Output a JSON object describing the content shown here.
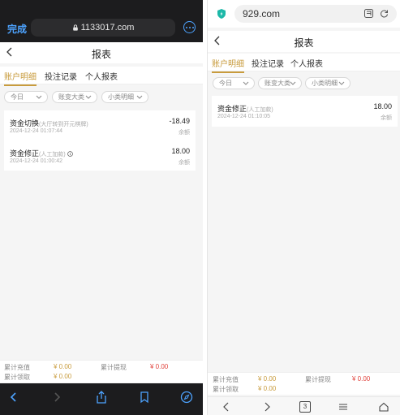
{
  "left": {
    "browser": {
      "done_label": "完成",
      "url": "1133017.com"
    },
    "page_title": "报表",
    "tabs": [
      {
        "label": "账户明细",
        "active": true
      },
      {
        "label": "投注记录",
        "active": false
      },
      {
        "label": "个人报表",
        "active": false
      }
    ],
    "filters": [
      {
        "label": "今日"
      },
      {
        "label": "账变大类"
      },
      {
        "label": "小类明细"
      }
    ],
    "records": [
      {
        "name": "资金切换",
        "note": "(大厅转到开元棋牌)",
        "date": "2024-12-24 01:07:44",
        "amount": "-18.49",
        "balance": "余额",
        "has_info": false
      },
      {
        "name": "资金修正",
        "note": "(人工加款)",
        "date": "2024-12-24 01:00:42",
        "amount": "18.00",
        "balance": "余额",
        "has_info": true
      }
    ],
    "summary": {
      "deposit_label": "累计充值",
      "deposit_value": "¥ 0.00",
      "withdraw_label": "累计提现",
      "withdraw_value": "¥ 0.00",
      "claim_label": "累计领取",
      "claim_value": "¥ 0.00"
    }
  },
  "right": {
    "browser": {
      "url": "929.com",
      "tab_count": "3"
    },
    "page_title": "报表",
    "tabs": [
      {
        "label": "账户明细",
        "active": true
      },
      {
        "label": "投注记录",
        "active": false
      },
      {
        "label": "个人报表",
        "active": false
      }
    ],
    "filters": [
      {
        "label": "今日"
      },
      {
        "label": "账变大类"
      },
      {
        "label": "小类明细"
      }
    ],
    "records": [
      {
        "name": "资金修正",
        "note": "(人工加款)",
        "date": "2024-12-24 01:10:05",
        "amount": "18.00",
        "balance": "余额"
      }
    ],
    "summary": {
      "deposit_label": "累计充值",
      "deposit_value": "¥ 0.00",
      "withdraw_label": "累计提现",
      "withdraw_value": "¥ 0.00",
      "claim_label": "累计领取",
      "claim_value": "¥ 0.00"
    }
  },
  "colors": {
    "accent_gold": "#c89b3c",
    "negative_red": "#e0413b",
    "ios_blue": "#4da3ff",
    "shield_teal": "#1db8a8"
  },
  "icons": [
    "lock-icon",
    "more-icon",
    "back-icon",
    "chevron-down-icon",
    "info-icon",
    "shield-icon",
    "tabs-icon",
    "reload-icon",
    "share-icon",
    "bookmarks-icon",
    "compass-icon",
    "forward-icon",
    "menu-icon",
    "home-icon"
  ]
}
